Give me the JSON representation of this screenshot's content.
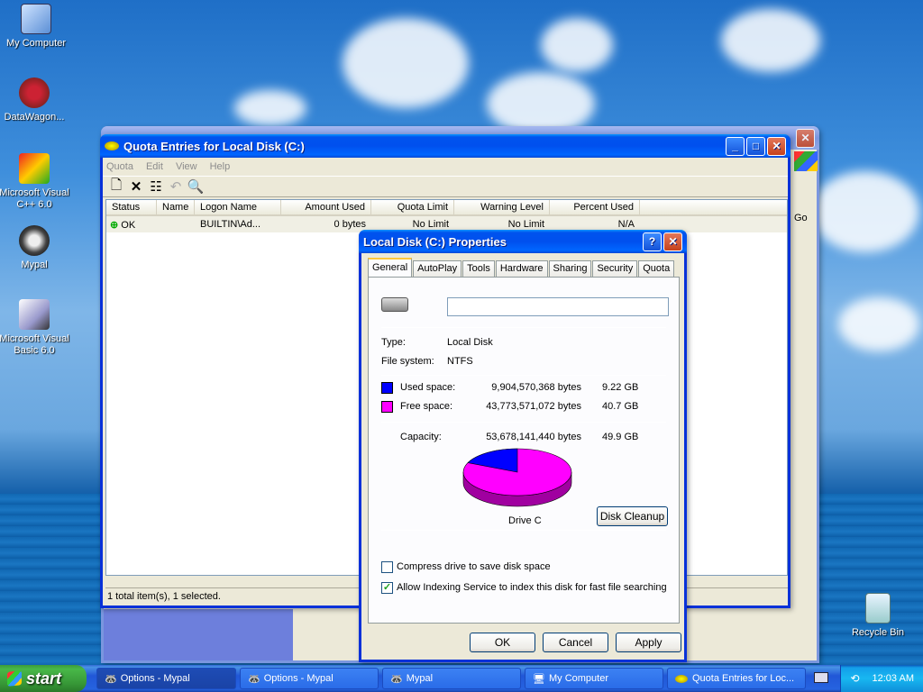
{
  "desktop": {
    "icons": [
      {
        "label": "My Computer"
      },
      {
        "label": "DataWagon..."
      },
      {
        "label": "Microsoft Visual C++ 6.0"
      },
      {
        "label": "Mypal"
      },
      {
        "label": "Microsoft Visual Basic 6.0"
      },
      {
        "label": "Recycle Bin"
      }
    ]
  },
  "bg_window": {
    "go_label": "Go"
  },
  "quota_window": {
    "title": "Quota Entries for Local Disk (C:)",
    "menu": [
      "Quota",
      "Edit",
      "View",
      "Help"
    ],
    "columns": [
      "Status",
      "Name",
      "Logon Name",
      "Amount Used",
      "Quota Limit",
      "Warning Level",
      "Percent Used"
    ],
    "row": {
      "status": "OK",
      "name": "",
      "logon": "BUILTIN\\Ad...",
      "amount": "0 bytes",
      "quota": "No Limit",
      "warning": "No Limit",
      "percent": "N/A"
    },
    "status_text": "1 total item(s), 1 selected."
  },
  "props_dialog": {
    "title": "Local Disk (C:) Properties",
    "tabs": [
      "General",
      "AutoPlay",
      "Tools",
      "Hardware",
      "Sharing",
      "Security",
      "Quota"
    ],
    "name_value": "",
    "type_label": "Type:",
    "type_value": "Local Disk",
    "fs_label": "File system:",
    "fs_value": "NTFS",
    "used_label": "Used space:",
    "used_bytes": "9,904,570,368 bytes",
    "used_gb": "9.22 GB",
    "free_label": "Free space:",
    "free_bytes": "43,773,571,072 bytes",
    "free_gb": "40.7 GB",
    "cap_label": "Capacity:",
    "cap_bytes": "53,678,141,440 bytes",
    "cap_gb": "49.9 GB",
    "drive_label": "Drive C",
    "cleanup_label": "Disk Cleanup",
    "compress_label": "Compress drive to save disk space",
    "compress_checked": false,
    "index_label": "Allow Indexing Service to index this disk for fast file searching",
    "index_checked": true,
    "ok_label": "OK",
    "cancel_label": "Cancel",
    "apply_label": "Apply",
    "colors": {
      "used": "#0000ff",
      "free": "#ff00ff"
    },
    "used_fraction": 0.1845
  },
  "taskbar": {
    "start_label": "start",
    "items": [
      {
        "label": "Options - Mypal"
      },
      {
        "label": "Options - Mypal"
      },
      {
        "label": "Mypal"
      },
      {
        "label": "My Computer"
      },
      {
        "label": "Quota Entries for Loc..."
      }
    ],
    "clock": "12:03 AM"
  }
}
